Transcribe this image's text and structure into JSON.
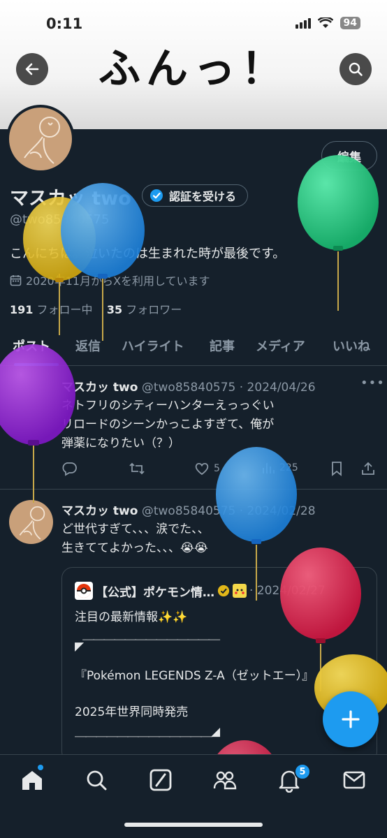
{
  "status_bar": {
    "time": "0:11",
    "battery": "94"
  },
  "banner": {
    "title": "ふんっ！"
  },
  "profile": {
    "edit_label": "編集",
    "name": "マスカッ two",
    "verify_label": "認証を受ける",
    "handle": "@two85840575",
    "bio": "こんにちは。泣いたのは生まれた時が最後です。",
    "joined": "2020年11月からXを利用しています",
    "following_count": "191",
    "following_label": "フォロー中",
    "followers_count": "35",
    "followers_label": "フォロワー"
  },
  "tabs": [
    "ポスト",
    "返信",
    "ハイライト",
    "記事",
    "メディア",
    "いいね"
  ],
  "tweets": [
    {
      "name": "マスカッ two",
      "handle": "@two85840575",
      "date": "· 2024/04/26",
      "lines": [
        "ネトフリのシティーハンターえっっぐい",
        "リロードのシーンかっこよすぎて、俺が",
        "弾薬になりたい（？）"
      ],
      "likes": "5",
      "views": "225"
    },
    {
      "name": "マスカッ two",
      "handle": "@two85840575",
      "date": "· 2024/02/28",
      "lines": [
        "ど世代すぎて、、、涙でた、、",
        "生きててよかった、、、😭😭"
      ],
      "quote": {
        "name": "【公式】ポケモン情…",
        "date": "· 2024/02/27",
        "lines": [
          "注目の最新情報✨✨",
          "◤￣￣￣￣￣￣￣￣￣￣￣￣￣",
          "『Pokémon LEGENDS Z-A（ゼットエー）』",
          "2025年世界同時発売",
          "＿＿＿＿＿＿＿＿＿＿＿＿＿◢"
        ]
      }
    }
  ],
  "bottom_nav": {
    "notification_count": "5"
  },
  "colors": {
    "background": "#15202b",
    "accent": "#1d9bf0",
    "muted": "#8b98a5"
  }
}
